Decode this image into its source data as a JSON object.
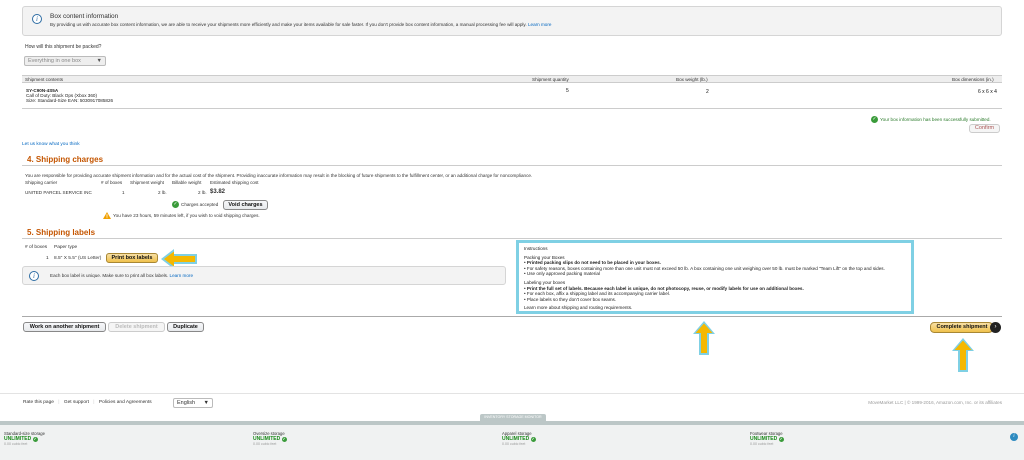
{
  "box_info": {
    "title": "Box content information",
    "text": "By providing us with accurate box content information, we are able to receive your shipments more efficiently and make your items available for sale faster. If you don't provide box content information, a manual processing fee will apply.",
    "learn_more": "Learn more"
  },
  "packing": {
    "question": "How will this shipment be packed?",
    "selected": "Everything in one box"
  },
  "contents_table": {
    "headers": [
      "Shipment contents",
      "Shipment quantity",
      "Box weight (lb.)",
      "Box dimensions (in.)"
    ],
    "row": {
      "sku": "SY-C90N-4S5A",
      "title": "Call of Duty: Black Ops (Xbox 360)",
      "size": "Size:  Standard-Size  EAN:  5030917085826",
      "quantity": "5",
      "weight": "2",
      "dimensions": "6 x 6 x 4"
    }
  },
  "box_submitted": {
    "message": "Your box information has been successfully submitted.",
    "confirm": "Confirm"
  },
  "feedback_link": "Let us know what you think",
  "shipping_charges": {
    "heading": "4. Shipping charges",
    "disclaimer": "You are responsible for providing accurate shipment information and for the actual cost of the shipment. Providing inaccurate information may result in the blocking of future shipments to the fulfillment center, or an additional charge for noncompliance.",
    "headers": [
      "Shipping carrier",
      "# of boxes",
      "Shipment weight",
      "Billable weight",
      "Estimated shipping cost"
    ],
    "carrier": "UNITED PARCEL SERVICE INC",
    "boxes": "1",
    "shipment_weight": "2 lb.",
    "billable_weight": "2 lb.",
    "cost": "$3.82",
    "accepted": "Charges accepted",
    "void_button": "Void charges",
    "warning": "You have 23 hours, 59 minutes left, if you wish to void shipping charges."
  },
  "shipping_labels": {
    "heading": "5. Shipping labels",
    "headers": [
      "# of boxes",
      "Paper type"
    ],
    "count": "1",
    "paper": "8.5\" X 5.5\" (US Letter)",
    "print_button": "Print box labels",
    "unique_note": "Each box label is unique. Make sure to print all box labels.",
    "learn_more": "Learn more"
  },
  "instructions": {
    "title": "Instructions",
    "packing_title": "Packing your Boxes",
    "packing_items": [
      "Printed packing slips do not need to be placed in your boxes.",
      "For safety reasons, boxes containing more than one unit must not exceed 50 lb. A box containing one unit weighing over 50 lb. must be marked \"Team Lift\" on the top and sides.",
      "Use only approved packing material"
    ],
    "labeling_title": "Labeling your boxes",
    "labeling_items": [
      "Print the full set of labels. Because each label is unique, do not photocopy, reuse, or modify labels for use on additional boxes.",
      "For each box, affix a shipping label and its accompanying carrier label.",
      "Place labels so they don't cover box seams."
    ],
    "learn_more": "Learn more about shipping and routing requirements."
  },
  "actions": {
    "work_on_another": "Work on another shipment",
    "delete": "Delete shipment",
    "duplicate": "Duplicate",
    "complete": "Complete shipment"
  },
  "footer": {
    "rate": "Rate this page",
    "support": "Get support",
    "policies": "Policies and Agreements",
    "language": "English",
    "copyright": "MoveMarket LLC  |  © 1999-2016, Amazon.com, Inc. or its affiliates"
  },
  "storage": {
    "tab": "INVENTORY STORAGE MONITOR",
    "items": [
      {
        "label": "Standard-size storage",
        "value": "UNLIMITED",
        "sub": "0.00 cubic feet"
      },
      {
        "label": "Oversize storage",
        "value": "UNLIMITED",
        "sub": "0.00 cubic feet"
      },
      {
        "label": "Apparel storage",
        "value": "UNLIMITED",
        "sub": "0.00 cubic feet"
      },
      {
        "label": "Footwear storage",
        "value": "UNLIMITED",
        "sub": "0.00 cubic feet"
      }
    ]
  },
  "colors": {
    "section_heading": "#c45500",
    "highlight": "#7fd0e4",
    "arrow": "#f5b800"
  }
}
